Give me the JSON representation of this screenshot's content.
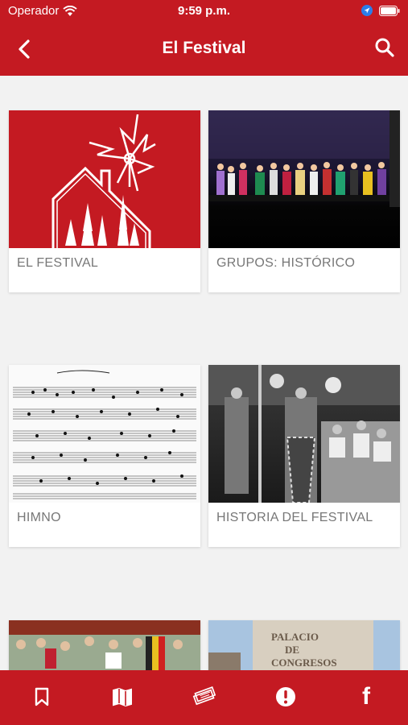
{
  "status_bar": {
    "carrier": "Operador",
    "time": "9:59 p.m."
  },
  "nav": {
    "title": "El Festival",
    "back_icon": "chevron-left-icon",
    "search_icon": "search-icon"
  },
  "cards": [
    {
      "label": "EL FESTIVAL",
      "image": "festival-logo"
    },
    {
      "label": "GRUPOS: HISTÓRICO",
      "image": "stage-performance-photo"
    },
    {
      "label": "HIMNO",
      "image": "sheet-music-photo"
    },
    {
      "label": "HISTORIA DEL FESTIVAL",
      "image": "historic-dance-photo"
    },
    {
      "label": "",
      "image": "crowd-flags-photo"
    },
    {
      "label": "",
      "image": "palacio-congresos-photo",
      "sign_text": "PALACIO DE CONGRESOS"
    }
  ],
  "tabbar": {
    "items": [
      {
        "icon": "bookmark-icon"
      },
      {
        "icon": "map-icon"
      },
      {
        "icon": "tickets-icon"
      },
      {
        "icon": "alert-icon"
      },
      {
        "icon": "facebook-icon",
        "text": "f"
      }
    ]
  },
  "colors": {
    "brand": "#c41a22",
    "background": "#f2f2f2",
    "label": "#777777"
  }
}
